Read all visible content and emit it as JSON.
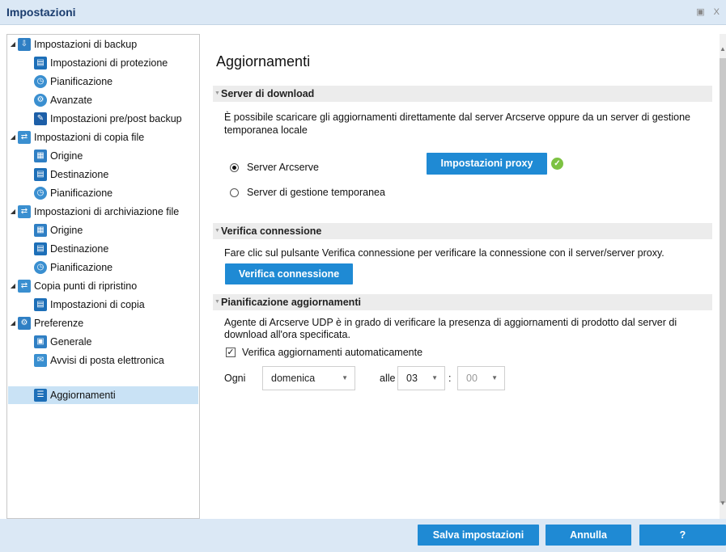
{
  "window": {
    "title": "Impostazioni",
    "controls": "▣ X"
  },
  "tree": {
    "items": [
      {
        "label": "Impostazioni di backup",
        "icon": "backup-icon",
        "color": "#2f7fc4",
        "level": 0
      },
      {
        "label": "Impostazioni di protezione",
        "icon": "protection-icon",
        "color": "#1d6fb8",
        "level": 1
      },
      {
        "label": "Pianificazione",
        "icon": "schedule-icon",
        "color": "#3a8fd0",
        "level": 1
      },
      {
        "label": "Avanzate",
        "icon": "advanced-icon",
        "color": "#3a8fd0",
        "level": 1
      },
      {
        "label": "Impostazioni pre/post backup",
        "icon": "wrench-icon",
        "color": "#1d5fa8",
        "level": 1
      },
      {
        "label": "Impostazioni di copia file",
        "icon": "file-copy-icon",
        "color": "#3a8fd0",
        "level": 0
      },
      {
        "label": "Origine",
        "icon": "source-icon",
        "color": "#2f7fc4",
        "level": 1
      },
      {
        "label": "Destinazione",
        "icon": "destination-icon",
        "color": "#1d6fb8",
        "level": 1
      },
      {
        "label": "Pianificazione",
        "icon": "schedule-icon",
        "color": "#3a8fd0",
        "level": 1
      },
      {
        "label": "Impostazioni di archiviazione file",
        "icon": "file-archive-icon",
        "color": "#3a8fd0",
        "level": 0
      },
      {
        "label": "Origine",
        "icon": "source-icon",
        "color": "#2f7fc4",
        "level": 1
      },
      {
        "label": "Destinazione",
        "icon": "destination-icon",
        "color": "#1d6fb8",
        "level": 1
      },
      {
        "label": "Pianificazione",
        "icon": "schedule-icon",
        "color": "#3a8fd0",
        "level": 1
      },
      {
        "label": "Copia punti di ripristino",
        "icon": "recovery-point-copy-icon",
        "color": "#3a8fd0",
        "level": 0
      },
      {
        "label": "Impostazioni di copia",
        "icon": "copy-settings-icon",
        "color": "#1d6fb8",
        "level": 1
      },
      {
        "label": "Preferenze",
        "icon": "preferences-icon",
        "color": "#2f7fc4",
        "level": 0
      },
      {
        "label": "Generale",
        "icon": "general-icon",
        "color": "#2f7fc4",
        "level": 1
      },
      {
        "label": "Avvisi di posta elettronica",
        "icon": "email-icon",
        "color": "#3a8fd0",
        "level": 1
      },
      {
        "label": "Aggiornamenti",
        "icon": "updates-icon",
        "color": "#1d6fb8",
        "level": 1,
        "selected": true
      }
    ]
  },
  "content": {
    "title": "Aggiornamenti",
    "download_server": {
      "header": "Server di download",
      "description": "È possibile scaricare gli aggiornamenti direttamente dal server Arcserve oppure da un server di gestione temporanea locale",
      "option_arcserve": "Server Arcserve",
      "option_staging": "Server di gestione temporanea",
      "proxy_button": "Impostazioni proxy"
    },
    "connection": {
      "header": "Verifica connessione",
      "description": "Fare clic sul pulsante Verifica connessione per verificare la connessione con il server/server proxy.",
      "button": "Verifica connessione"
    },
    "schedule": {
      "header": "Pianificazione aggiornamenti",
      "description": "Agente di Arcserve UDP è in grado di verificare la presenza di aggiornamenti di prodotto dal server di download all'ora specificata.",
      "auto_check_label": "Verifica aggiornamenti automaticamente",
      "every_label": "Ogni",
      "day_value": "domenica",
      "at_label": "alle",
      "hour_value": "03",
      "separator": ":",
      "minute_value": "00"
    }
  },
  "footer": {
    "save_button": "Salva impostazioni",
    "cancel_button": "Annulla",
    "help_button": "?"
  },
  "colors": {
    "accent": "#1f8ad4",
    "selection": "#c9e2f5",
    "titlebar": "#dbe8f5",
    "ok": "#7dc242"
  }
}
